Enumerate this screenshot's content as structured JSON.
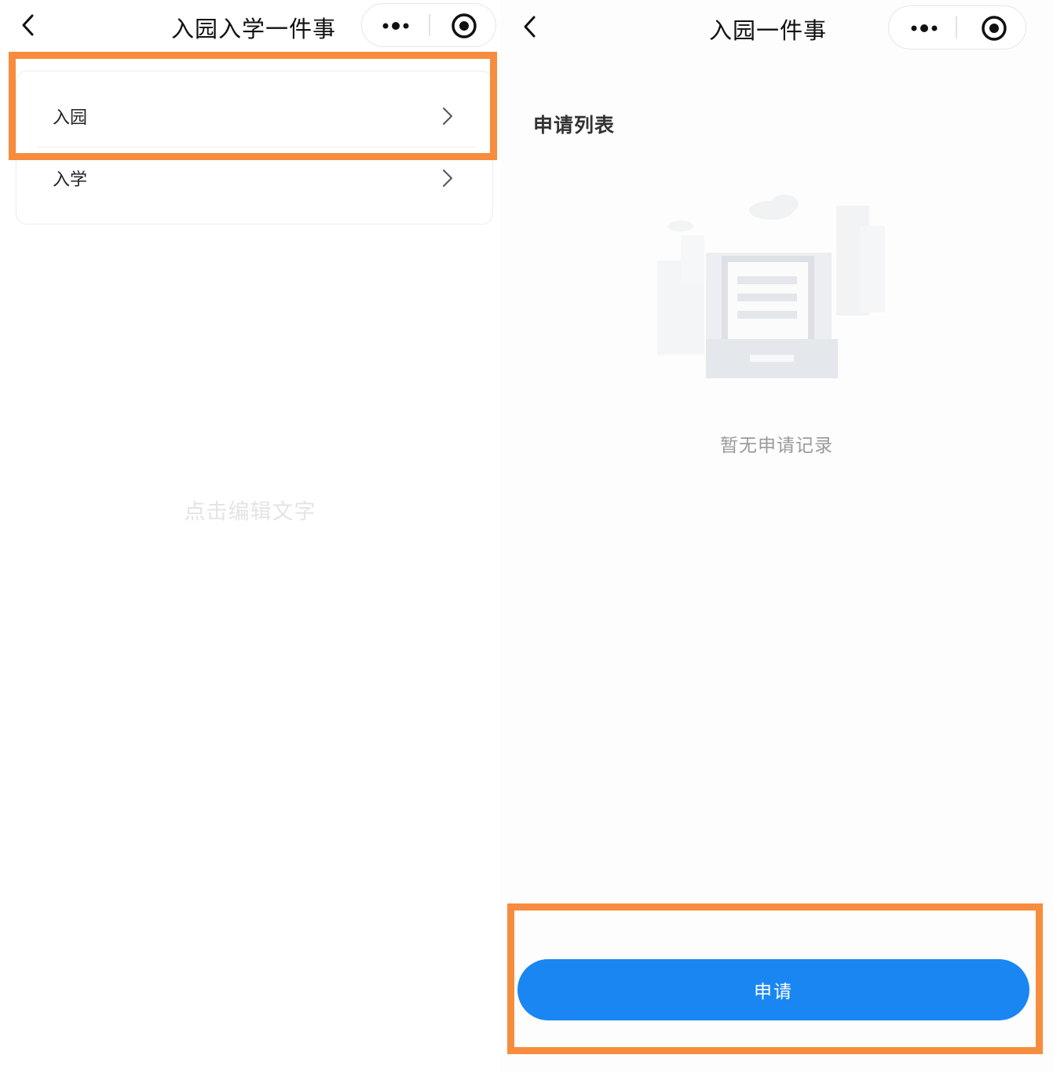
{
  "left_screen": {
    "nav": {
      "title": "入园入学一件事",
      "back_icon": "chevron-left-icon",
      "more_icon": "more-dots-icon",
      "close_icon": "target-circle-icon"
    },
    "list": {
      "items": [
        {
          "label": "入园",
          "icon": "chevron-right-icon"
        },
        {
          "label": "入学",
          "icon": "chevron-right-icon"
        }
      ]
    },
    "hint": "点击编辑文字"
  },
  "right_screen": {
    "nav": {
      "title": "入园一件事",
      "back_icon": "chevron-left-icon",
      "more_icon": "more-dots-icon",
      "close_icon": "target-circle-icon"
    },
    "section_title": "申请列表",
    "empty_state": {
      "icon": "empty-document-illustration",
      "text": "暂无申请记录"
    },
    "apply_button": {
      "label": "申请"
    }
  },
  "colors": {
    "highlight": "#f78c3e",
    "primary_button": "#1a86f2",
    "hint_text": "#e4e4e4"
  }
}
